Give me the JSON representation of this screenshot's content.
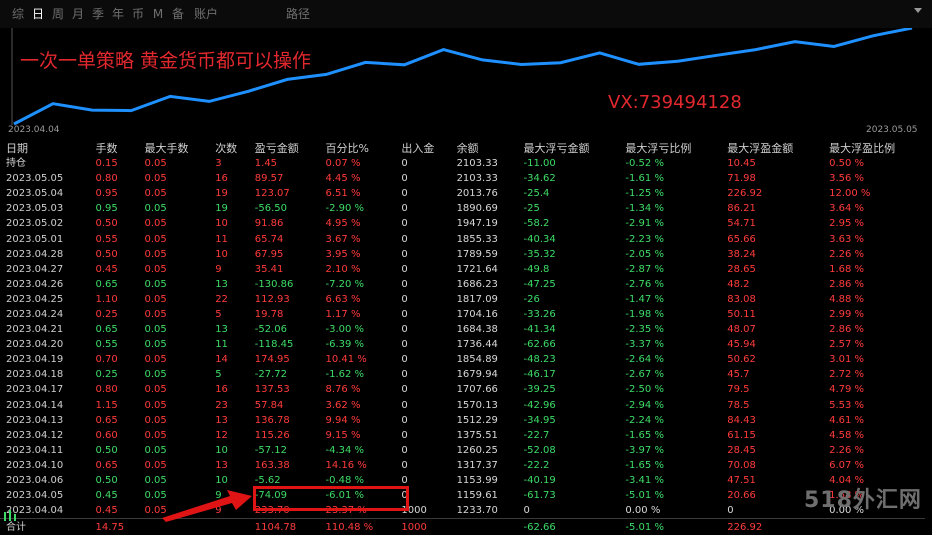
{
  "tabs": [
    "综",
    "日",
    "周",
    "月",
    "季",
    "年",
    "币",
    "M",
    "备",
    "账户",
    "路径"
  ],
  "active_tab": "日",
  "chart": {
    "title": "一次一单策略 黄金货币都可以操作",
    "contact": "VX:739494128",
    "date_start": "2023.04.04",
    "date_end": "2023.05.05",
    "line_color": "#1e90ff"
  },
  "table": {
    "headers": [
      "日期",
      "手数",
      "最大手数",
      "次数",
      "盈亏金额",
      "百分比%",
      "出入金",
      "余额",
      "最大浮亏金额",
      "最大浮亏比例",
      "最大浮盈金额",
      "最大浮盈比例"
    ],
    "rows": [
      {
        "date": "持仓",
        "lots": "0.15",
        "max_lots": "0.05",
        "count": "3",
        "pnl": "1.45",
        "pct": "0.07 %",
        "io": "0",
        "balance": "2103.33",
        "max_loss": "-11.00",
        "max_loss_pct": "-0.52 %",
        "max_gain": "10.45",
        "max_gain_pct": "0.50 %",
        "c": "red"
      },
      {
        "date": "2023.05.05",
        "lots": "0.80",
        "max_lots": "0.05",
        "count": "16",
        "pnl": "89.57",
        "pct": "4.45 %",
        "io": "0",
        "balance": "2103.33",
        "max_loss": "-34.62",
        "max_loss_pct": "-1.61 %",
        "max_gain": "71.98",
        "max_gain_pct": "3.56 %",
        "c": "red"
      },
      {
        "date": "2023.05.04",
        "lots": "0.95",
        "max_lots": "0.05",
        "count": "19",
        "pnl": "123.07",
        "pct": "6.51 %",
        "io": "0",
        "balance": "2013.76",
        "max_loss": "-25.4",
        "max_loss_pct": "-1.25 %",
        "max_gain": "226.92",
        "max_gain_pct": "12.00 %",
        "c": "red"
      },
      {
        "date": "2023.05.03",
        "lots": "0.95",
        "max_lots": "0.05",
        "count": "19",
        "pnl": "-56.50",
        "pct": "-2.90 %",
        "io": "0",
        "balance": "1890.69",
        "max_loss": "-25",
        "max_loss_pct": "-1.34 %",
        "max_gain": "86.21",
        "max_gain_pct": "3.64 %",
        "c": "green"
      },
      {
        "date": "2023.05.02",
        "lots": "0.50",
        "max_lots": "0.05",
        "count": "10",
        "pnl": "91.86",
        "pct": "4.95 %",
        "io": "0",
        "balance": "1947.19",
        "max_loss": "-58.2",
        "max_loss_pct": "-2.91 %",
        "max_gain": "54.71",
        "max_gain_pct": "2.95 %",
        "c": "red"
      },
      {
        "date": "2023.05.01",
        "lots": "0.55",
        "max_lots": "0.05",
        "count": "11",
        "pnl": "65.74",
        "pct": "3.67 %",
        "io": "0",
        "balance": "1855.33",
        "max_loss": "-40.34",
        "max_loss_pct": "-2.23 %",
        "max_gain": "65.66",
        "max_gain_pct": "3.63 %",
        "c": "red"
      },
      {
        "date": "2023.04.28",
        "lots": "0.50",
        "max_lots": "0.05",
        "count": "10",
        "pnl": "67.95",
        "pct": "3.95 %",
        "io": "0",
        "balance": "1789.59",
        "max_loss": "-35.32",
        "max_loss_pct": "-2.05 %",
        "max_gain": "38.24",
        "max_gain_pct": "2.26 %",
        "c": "red"
      },
      {
        "date": "2023.04.27",
        "lots": "0.45",
        "max_lots": "0.05",
        "count": "9",
        "pnl": "35.41",
        "pct": "2.10 %",
        "io": "0",
        "balance": "1721.64",
        "max_loss": "-49.8",
        "max_loss_pct": "-2.87 %",
        "max_gain": "28.65",
        "max_gain_pct": "1.68 %",
        "c": "red"
      },
      {
        "date": "2023.04.26",
        "lots": "0.65",
        "max_lots": "0.05",
        "count": "13",
        "pnl": "-130.86",
        "pct": "-7.20 %",
        "io": "0",
        "balance": "1686.23",
        "max_loss": "-47.25",
        "max_loss_pct": "-2.76 %",
        "max_gain": "48.2",
        "max_gain_pct": "2.86 %",
        "c": "green"
      },
      {
        "date": "2023.04.25",
        "lots": "1.10",
        "max_lots": "0.05",
        "count": "22",
        "pnl": "112.93",
        "pct": "6.63 %",
        "io": "0",
        "balance": "1817.09",
        "max_loss": "-26",
        "max_loss_pct": "-1.47 %",
        "max_gain": "83.08",
        "max_gain_pct": "4.88 %",
        "c": "red"
      },
      {
        "date": "2023.04.24",
        "lots": "0.25",
        "max_lots": "0.05",
        "count": "5",
        "pnl": "19.78",
        "pct": "1.17 %",
        "io": "0",
        "balance": "1704.16",
        "max_loss": "-33.26",
        "max_loss_pct": "-1.98 %",
        "max_gain": "50.11",
        "max_gain_pct": "2.99 %",
        "c": "red"
      },
      {
        "date": "2023.04.21",
        "lots": "0.65",
        "max_lots": "0.05",
        "count": "13",
        "pnl": "-52.06",
        "pct": "-3.00 %",
        "io": "0",
        "balance": "1684.38",
        "max_loss": "-41.34",
        "max_loss_pct": "-2.35 %",
        "max_gain": "48.07",
        "max_gain_pct": "2.86 %",
        "c": "green"
      },
      {
        "date": "2023.04.20",
        "lots": "0.55",
        "max_lots": "0.05",
        "count": "11",
        "pnl": "-118.45",
        "pct": "-6.39 %",
        "io": "0",
        "balance": "1736.44",
        "max_loss": "-62.66",
        "max_loss_pct": "-3.37 %",
        "max_gain": "45.94",
        "max_gain_pct": "2.57 %",
        "c": "green"
      },
      {
        "date": "2023.04.19",
        "lots": "0.70",
        "max_lots": "0.05",
        "count": "14",
        "pnl": "174.95",
        "pct": "10.41 %",
        "io": "0",
        "balance": "1854.89",
        "max_loss": "-48.23",
        "max_loss_pct": "-2.64 %",
        "max_gain": "50.62",
        "max_gain_pct": "3.01 %",
        "c": "red"
      },
      {
        "date": "2023.04.18",
        "lots": "0.25",
        "max_lots": "0.05",
        "count": "5",
        "pnl": "-27.72",
        "pct": "-1.62 %",
        "io": "0",
        "balance": "1679.94",
        "max_loss": "-46.17",
        "max_loss_pct": "-2.67 %",
        "max_gain": "45.7",
        "max_gain_pct": "2.72 %",
        "c": "green"
      },
      {
        "date": "2023.04.17",
        "lots": "0.80",
        "max_lots": "0.05",
        "count": "16",
        "pnl": "137.53",
        "pct": "8.76 %",
        "io": "0",
        "balance": "1707.66",
        "max_loss": "-39.25",
        "max_loss_pct": "-2.50 %",
        "max_gain": "79.5",
        "max_gain_pct": "4.79 %",
        "c": "red"
      },
      {
        "date": "2023.04.14",
        "lots": "1.15",
        "max_lots": "0.05",
        "count": "23",
        "pnl": "57.84",
        "pct": "3.62 %",
        "io": "0",
        "balance": "1570.13",
        "max_loss": "-42.96",
        "max_loss_pct": "-2.94 %",
        "max_gain": "78.5",
        "max_gain_pct": "5.53 %",
        "c": "red"
      },
      {
        "date": "2023.04.13",
        "lots": "0.65",
        "max_lots": "0.05",
        "count": "13",
        "pnl": "136.78",
        "pct": "9.94 %",
        "io": "0",
        "balance": "1512.29",
        "max_loss": "-34.95",
        "max_loss_pct": "-2.24 %",
        "max_gain": "84.43",
        "max_gain_pct": "4.61 %",
        "c": "red"
      },
      {
        "date": "2023.04.12",
        "lots": "0.60",
        "max_lots": "0.05",
        "count": "12",
        "pnl": "115.26",
        "pct": "9.15 %",
        "io": "0",
        "balance": "1375.51",
        "max_loss": "-22.7",
        "max_loss_pct": "-1.65 %",
        "max_gain": "61.15",
        "max_gain_pct": "4.58 %",
        "c": "red"
      },
      {
        "date": "2023.04.11",
        "lots": "0.50",
        "max_lots": "0.05",
        "count": "10",
        "pnl": "-57.12",
        "pct": "-4.34 %",
        "io": "0",
        "balance": "1260.25",
        "max_loss": "-52.08",
        "max_loss_pct": "-3.97 %",
        "max_gain": "28.45",
        "max_gain_pct": "2.26 %",
        "c": "green"
      },
      {
        "date": "2023.04.10",
        "lots": "0.65",
        "max_lots": "0.05",
        "count": "13",
        "pnl": "163.38",
        "pct": "14.16 %",
        "io": "0",
        "balance": "1317.37",
        "max_loss": "-22.2",
        "max_loss_pct": "-1.65 %",
        "max_gain": "70.08",
        "max_gain_pct": "6.07 %",
        "c": "red"
      },
      {
        "date": "2023.04.06",
        "lots": "0.50",
        "max_lots": "0.05",
        "count": "10",
        "pnl": "-5.62",
        "pct": "-0.48 %",
        "io": "0",
        "balance": "1153.99",
        "max_loss": "-40.19",
        "max_loss_pct": "-3.41 %",
        "max_gain": "47.51",
        "max_gain_pct": "4.04 %",
        "c": "green"
      },
      {
        "date": "2023.04.05",
        "lots": "0.45",
        "max_lots": "0.05",
        "count": "9",
        "pnl": "-74.09",
        "pct": "-6.01 %",
        "io": "0",
        "balance": "1159.61",
        "max_loss": "-61.73",
        "max_loss_pct": "-5.01 %",
        "max_gain": "20.66",
        "max_gain_pct": "1.68 %",
        "c": "green"
      },
      {
        "date": "2023.04.04",
        "lots": "0.45",
        "max_lots": "0.05",
        "count": "9",
        "pnl": "233.70",
        "pct": "23.37 %",
        "io": "1000",
        "balance": "1233.70",
        "max_loss": "0",
        "max_loss_pct": "0.00 %",
        "max_gain": "0",
        "max_gain_pct": "0.00 %",
        "c": "red"
      }
    ],
    "total": {
      "date": "合计",
      "lots": "14.75",
      "pnl": "1104.78",
      "pct": "110.48 %",
      "io": "1000",
      "max_loss": "-62.66",
      "max_loss_pct": "-5.01 %",
      "max_gain": "226.92"
    }
  },
  "watermark": "518外汇网",
  "highlight_color": "#e01414"
}
